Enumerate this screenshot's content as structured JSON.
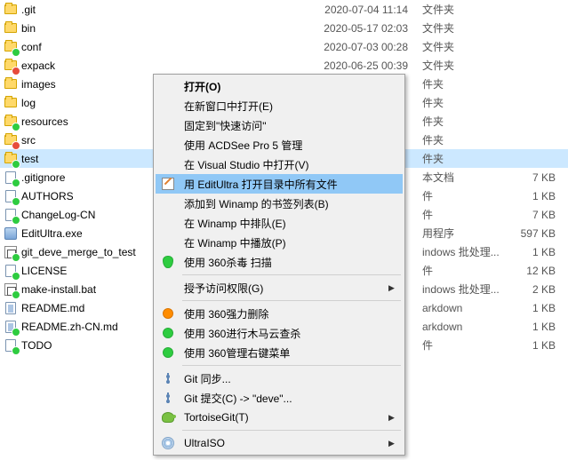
{
  "files": [
    {
      "name": ".git",
      "date": "2020-07-04 11:14",
      "type": "文件夹",
      "size": "",
      "icon": "folder",
      "overlay": ""
    },
    {
      "name": "bin",
      "date": "2020-05-17 02:03",
      "type": "文件夹",
      "size": "",
      "icon": "folder",
      "overlay": ""
    },
    {
      "name": "conf",
      "date": "2020-07-03 00:28",
      "type": "文件夹",
      "size": "",
      "icon": "folder",
      "overlay": "green"
    },
    {
      "name": "expack",
      "date": "2020-06-25 00:39",
      "type": "文件夹",
      "size": "",
      "icon": "folder",
      "overlay": "red"
    },
    {
      "name": "images",
      "date": "",
      "type": "件夹",
      "size": "",
      "icon": "folder",
      "overlay": ""
    },
    {
      "name": "log",
      "date": "",
      "type": "件夹",
      "size": "",
      "icon": "folder",
      "overlay": ""
    },
    {
      "name": "resources",
      "date": "",
      "type": "件夹",
      "size": "",
      "icon": "folder",
      "overlay": "green"
    },
    {
      "name": "src",
      "date": "",
      "type": "件夹",
      "size": "",
      "icon": "folder",
      "overlay": "red"
    },
    {
      "name": "test",
      "date": "",
      "type": "件夹",
      "size": "",
      "icon": "folder",
      "overlay": "green",
      "selected": true
    },
    {
      "name": ".gitignore",
      "date": "",
      "type": "本文档",
      "size": "7 KB",
      "icon": "file",
      "overlay": "green"
    },
    {
      "name": "AUTHORS",
      "date": "",
      "type": "件",
      "size": "1 KB",
      "icon": "file",
      "overlay": "green"
    },
    {
      "name": "ChangeLog-CN",
      "date": "",
      "type": "件",
      "size": "7 KB",
      "icon": "file",
      "overlay": "green"
    },
    {
      "name": "EditUltra.exe",
      "date": "",
      "type": "用程序",
      "size": "597 KB",
      "icon": "exe",
      "overlay": ""
    },
    {
      "name": "git_deve_merge_to_test",
      "date": "",
      "type": "indows 批处理...",
      "size": "1 KB",
      "icon": "bat",
      "overlay": "green"
    },
    {
      "name": "LICENSE",
      "date": "",
      "type": "件",
      "size": "12 KB",
      "icon": "file",
      "overlay": "green"
    },
    {
      "name": "make-install.bat",
      "date": "",
      "type": "indows 批处理...",
      "size": "2 KB",
      "icon": "bat",
      "overlay": "green"
    },
    {
      "name": "README.md",
      "date": "",
      "type": "arkdown",
      "size": "1 KB",
      "icon": "md",
      "overlay": ""
    },
    {
      "name": "README.zh-CN.md",
      "date": "",
      "type": "arkdown",
      "size": "1 KB",
      "icon": "md",
      "overlay": "green"
    },
    {
      "name": "TODO",
      "date": "",
      "type": "件",
      "size": "1 KB",
      "icon": "file",
      "overlay": "green"
    }
  ],
  "menu": [
    {
      "kind": "item",
      "label": "打开(O)",
      "bold": true,
      "icon": ""
    },
    {
      "kind": "item",
      "label": "在新窗口中打开(E)",
      "icon": ""
    },
    {
      "kind": "item",
      "label": "固定到\"快速访问\"",
      "icon": ""
    },
    {
      "kind": "item",
      "label": "使用 ACDSee Pro 5 管理",
      "icon": ""
    },
    {
      "kind": "item",
      "label": "在 Visual Studio 中打开(V)",
      "icon": ""
    },
    {
      "kind": "item",
      "label": "用 EditUltra 打开目录中所有文件",
      "icon": "edit",
      "highlighted": true
    },
    {
      "kind": "item",
      "label": "添加到 Winamp 的书签列表(B)",
      "icon": ""
    },
    {
      "kind": "item",
      "label": "在 Winamp 中排队(E)",
      "icon": ""
    },
    {
      "kind": "item",
      "label": "在 Winamp 中播放(P)",
      "icon": ""
    },
    {
      "kind": "item",
      "label": "使用 360杀毒 扫描",
      "icon": "shield"
    },
    {
      "kind": "sep"
    },
    {
      "kind": "item",
      "label": "授予访问权限(G)",
      "icon": "",
      "arrow": true
    },
    {
      "kind": "sep"
    },
    {
      "kind": "item",
      "label": "使用 360强力删除",
      "icon": "360o"
    },
    {
      "kind": "item",
      "label": "使用 360进行木马云查杀",
      "icon": "360g"
    },
    {
      "kind": "item",
      "label": "使用 360管理右键菜单",
      "icon": "360g"
    },
    {
      "kind": "sep"
    },
    {
      "kind": "item",
      "label": "Git 同步...",
      "icon": "git"
    },
    {
      "kind": "item",
      "label": "Git 提交(C) -> \"deve\"...",
      "icon": "git"
    },
    {
      "kind": "item",
      "label": "TortoiseGit(T)",
      "icon": "tort",
      "arrow": true
    },
    {
      "kind": "sep"
    },
    {
      "kind": "item",
      "label": "UltraISO",
      "icon": "iso",
      "arrow": true
    }
  ]
}
